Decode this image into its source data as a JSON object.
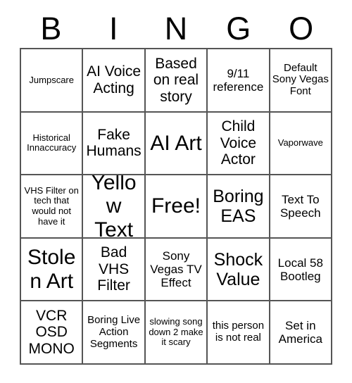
{
  "card": {
    "title": "BINGO",
    "header_letters": [
      "B",
      "I",
      "N",
      "G",
      "O"
    ],
    "columns": 5,
    "rows": 5,
    "colors": {
      "background": "#ffffff",
      "text": "#000000",
      "grid_line": "#555555"
    },
    "cells": [
      {
        "text": "Jumpscare",
        "size": "xs"
      },
      {
        "text": "AI Voice Acting",
        "size": "l"
      },
      {
        "text": "Based on real story",
        "size": "l"
      },
      {
        "text": "9/11 reference",
        "size": "m"
      },
      {
        "text": "Default Sony Vegas Font",
        "size": "s"
      },
      {
        "text": "Historical Innaccuracy",
        "size": "xs"
      },
      {
        "text": "Fake Humans",
        "size": "l"
      },
      {
        "text": "AI Art",
        "size": "xxl"
      },
      {
        "text": "Child Voice Actor",
        "size": "l"
      },
      {
        "text": "Vaporwave",
        "size": "xs"
      },
      {
        "text": "VHS Filter on tech that would not have it",
        "size": "xs"
      },
      {
        "text": "Yellow Text",
        "size": "xxl"
      },
      {
        "text": "Free!",
        "size": "xxl"
      },
      {
        "text": "Boring EAS",
        "size": "xl"
      },
      {
        "text": "Text To Speech",
        "size": "m"
      },
      {
        "text": "Stolen Art",
        "size": "xxl"
      },
      {
        "text": "Bad VHS Filter",
        "size": "l"
      },
      {
        "text": "Sony Vegas TV Effect",
        "size": "m"
      },
      {
        "text": "Shock Value",
        "size": "xl"
      },
      {
        "text": "Local 58 Bootleg",
        "size": "m"
      },
      {
        "text": "VCR OSD MONO",
        "size": "l"
      },
      {
        "text": "Boring Live Action Segments",
        "size": "s"
      },
      {
        "text": "slowing song down 2 make it scary",
        "size": "xs"
      },
      {
        "text": "this person is not real",
        "size": "s"
      },
      {
        "text": "Set in America",
        "size": "m"
      }
    ]
  }
}
